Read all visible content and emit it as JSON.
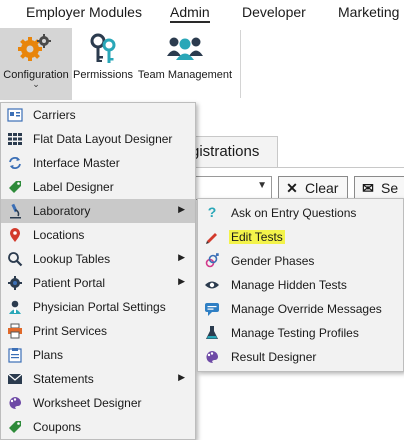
{
  "tabs": [
    "Employer Modules",
    "Admin",
    "Developer",
    "Marketing"
  ],
  "ribbon": {
    "configuration": "Configuration",
    "permissions": "Permissions",
    "team_management": "Team Management"
  },
  "background": {
    "tab_label": "gistrations",
    "clear_button": "Clear",
    "send_button": "Se"
  },
  "menu": [
    {
      "label": "Carriers",
      "icon": "carriers-icon"
    },
    {
      "label": "Flat Data Layout Designer",
      "icon": "grid-icon"
    },
    {
      "label": "Interface Master",
      "icon": "sync-icon"
    },
    {
      "label": "Label Designer",
      "icon": "tag-icon"
    },
    {
      "label": "Laboratory",
      "icon": "microscope-icon",
      "submenu": true
    },
    {
      "label": "Locations",
      "icon": "location-pin-icon"
    },
    {
      "label": "Lookup Tables",
      "icon": "magnifier-icon",
      "submenu": true
    },
    {
      "label": "Patient Portal",
      "icon": "gear-icon",
      "submenu": true
    },
    {
      "label": "Physician Portal Settings",
      "icon": "physician-icon"
    },
    {
      "label": "Print Services",
      "icon": "printer-icon"
    },
    {
      "label": "Plans",
      "icon": "clipboard-icon"
    },
    {
      "label": "Statements",
      "icon": "envelope-icon",
      "submenu": true
    },
    {
      "label": "Worksheet Designer",
      "icon": "palette-icon"
    },
    {
      "label": "Coupons",
      "icon": "coupon-icon"
    }
  ],
  "submenu": [
    {
      "label": "Ask on Entry Questions",
      "icon": "question-icon"
    },
    {
      "label": "Edit Tests",
      "icon": "pencil-icon"
    },
    {
      "label": "Gender Phases",
      "icon": "gender-icon"
    },
    {
      "label": "Manage Hidden Tests",
      "icon": "eye-icon"
    },
    {
      "label": "Manage Override Messages",
      "icon": "chat-icon"
    },
    {
      "label": "Manage Testing Profiles",
      "icon": "flask-icon"
    },
    {
      "label": "Result Designer",
      "icon": "palette-icon"
    }
  ],
  "colors": {
    "highlight_gray": "#c9c9c9",
    "edit_tests_highlight": "#f3f34a",
    "menu_bg": "#f2f2f2"
  }
}
